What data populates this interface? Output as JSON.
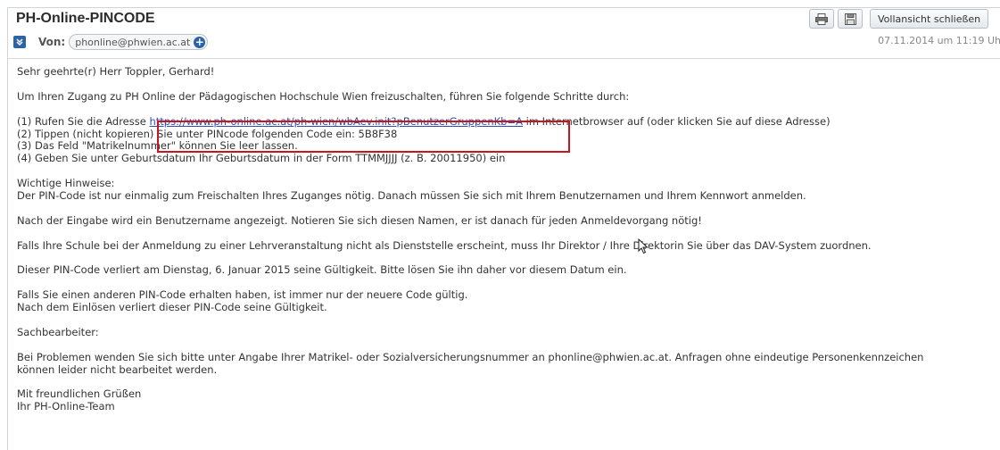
{
  "email": {
    "subject": "PH-Online-PINCODE",
    "from_label": "Von:",
    "from_address": "phonline@phwien.ac.at",
    "date": "07.11.2014 um 11:19 Uh"
  },
  "toolbar": {
    "close_label": "Vollansicht schließen"
  },
  "icons": {
    "mail": "mail-icon",
    "add_contact": "add-contact-icon",
    "print": "print-icon",
    "save": "save-icon",
    "cursor": "mouse-cursor-icon"
  },
  "colors": {
    "link": "#2a4fb0",
    "highlight_border": "#c8161e",
    "accent": "#2b63a8"
  },
  "body": {
    "greeting": "Sehr geehrte(r) Herr Toppler, Gerhard!",
    "intro": "Um Ihren Zugang zu PH Online der Pädagogischen Hochschule Wien freizuschalten, führen Sie folgende Schritte durch:",
    "step1_before": "(1) Rufen Sie die Adresse ",
    "step1_link": "https://www.ph-online.ac.at/ph-wien/wbAev.init?pBenutzerGruppenKb=A",
    "step1_after": " im Internetbrowser auf (oder klicken Sie auf diese Adresse)",
    "step2": "(2) Tippen (nicht kopieren) Sie unter PINcode folgenden Code ein: 5B8F38",
    "step3": "(3) Das Feld \"Matrikelnummer\" können Sie leer lassen.",
    "step4": "(4) Geben Sie unter Geburtsdatum Ihr Geburtsdatum in der Form TTMMJJJJ (z. B. 20011950) ein",
    "hints_title": "Wichtige Hinweise:",
    "hint1": "Der PIN-Code ist nur einmalig zum Freischalten Ihres Zuganges nötig. Danach müssen Sie sich mit Ihrem Benutzernamen und Ihrem Kennwort anmelden.",
    "hint2": "Nach der Eingabe wird ein Benutzername angezeigt. Notieren Sie sich diesen Namen, er ist danach für jeden Anmeldevorgang nötig!",
    "hint3": "Falls Ihre Schule bei der Anmeldung zu einer Lehrveranstaltung nicht als Dienststelle erscheint, muss Ihr Direktor / Ihre Direktorin Sie über das DAV-System zuordnen.",
    "hint4": "Dieser PIN-Code verliert am Dienstag, 6. Januar 2015 seine Gültigkeit. Bitte lösen Sie ihn daher vor diesem Datum ein.",
    "hint5a": "Falls Sie einen anderen PIN-Code erhalten haben, ist immer nur der neuere Code gültig.",
    "hint5b": "Nach dem Einlösen verliert dieser PIN-Code seine Gültigkeit.",
    "clerk": "Sachbearbeiter:",
    "problems1": "Bei Problemen wenden Sie sich bitte unter Angabe Ihrer Matrikel- oder Sozialversicherungsnummer an phonline@phwien.ac.at. Anfragen ohne eindeutige Personenkennzeichen",
    "problems2": "können leider nicht bearbeitet werden.",
    "closing1": "Mit freundlichen Grüßen",
    "closing2": "Ihr PH-Online-Team"
  }
}
